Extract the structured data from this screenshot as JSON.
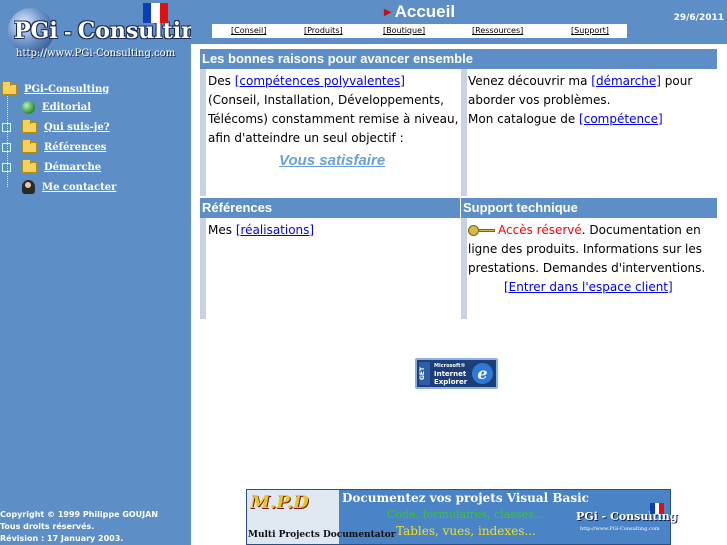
{
  "brand": {
    "name_prefix": "PGi",
    "name_sep": " - ",
    "name_suffix": "Consulting",
    "url": "http://www.PGi-Consulting.com"
  },
  "flag_colors": [
    "#0b3fb8",
    "#ffffff",
    "#e01010"
  ],
  "nav": {
    "root_label": "PGi-Consulting",
    "items": [
      {
        "label": "Editorial",
        "icon": "globe-page-icon"
      },
      {
        "label": "Qui suis-je?",
        "icon": "folder-icon"
      },
      {
        "label": "Références",
        "icon": "folder-icon"
      },
      {
        "label": "Démarche",
        "icon": "folder-icon"
      },
      {
        "label": "Me contacter",
        "icon": "person-icon"
      }
    ]
  },
  "copyright": {
    "line1": "Copyright © 1999 Philippe GOUJAN",
    "line2": "Tous droits réservés.",
    "line3": "Révision : 17 January 2003."
  },
  "header": {
    "title": "Accueil",
    "date": "29/6/2011",
    "tabs": [
      "[Conseil]",
      "[Produits]",
      "[Boutique]",
      "[Ressources]",
      "[Support]"
    ]
  },
  "panels": {
    "reasons": {
      "title": "Les bonnes raisons pour avancer ensemble",
      "left": {
        "text_before": "Des ",
        "link": "[compétences polyvalentes]",
        "text_after": " (Conseil, Installation, Développements, Télécoms) constamment remise à niveau, afin d'atteindre un seul objectif :",
        "cta": "Vous satisfaire"
      },
      "right": {
        "text1": "Venez découvrir ma ",
        "link1": "[démarche]",
        "text2": " pour aborder vos problèmes.",
        "text3": "Mon catalogue de ",
        "link2": "[compétence]"
      }
    },
    "references": {
      "title": "Références",
      "text": "Mes ",
      "link": "[réalisations]"
    },
    "support": {
      "title": "Support technique",
      "restricted": "Accès réservé",
      "text": ". Documentation en ligne des produits. Informations sur les prestations. Demandes d'interventions.",
      "link": "[Entrer dans l'espace client]"
    }
  },
  "ie_badge": {
    "get": "GET",
    "vendor": "Microsoft®",
    "line1": "Internet",
    "line2": "Explorer",
    "glyph": "e"
  },
  "banner": {
    "logo_text": "M.P.D",
    "subtitle": "Multi Projects Documentator",
    "headline": "Documentez vos projets Visual Basic",
    "line2": "Code, formulaires, classes...",
    "line3": "Tables, vues, indexes...",
    "mini_brand": "PGi - Consulting",
    "mini_url": "http://www.PGi-Consulting.com"
  }
}
